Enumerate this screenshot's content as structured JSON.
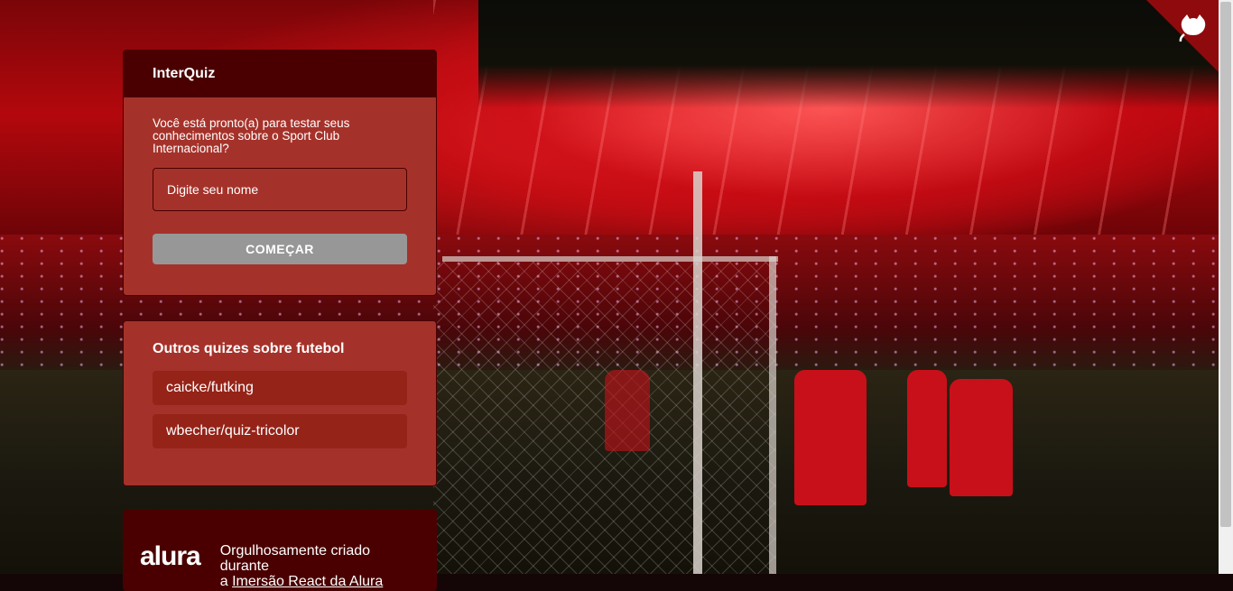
{
  "app": {
    "name": "InterQuiz"
  },
  "quiz_widget": {
    "title": "InterQuiz",
    "prompt": "Você está pronto(a) para testar seus conhecimentos sobre o Sport Club Internacional?",
    "name_input": {
      "value": "",
      "placeholder": "Digite seu nome"
    },
    "start_button": "COMEÇAR"
  },
  "other_quizzes": {
    "title": "Outros quizes sobre futebol",
    "links": [
      {
        "label": "caicke/futking"
      },
      {
        "label": "wbecher/quiz-tricolor"
      }
    ]
  },
  "footer": {
    "logo": "alura",
    "text_line1": "Orgulhosamente criado durante",
    "text_line2_prefix": "a ",
    "text_link": "Imersão React da Alura"
  },
  "corner_icon": "github-octocat-icon",
  "colors": {
    "primary": "#4a0000",
    "widget_bg": "#a5322a",
    "link_bg": "#952318",
    "button": "#979797",
    "ribbon": "#8e0a0d"
  }
}
